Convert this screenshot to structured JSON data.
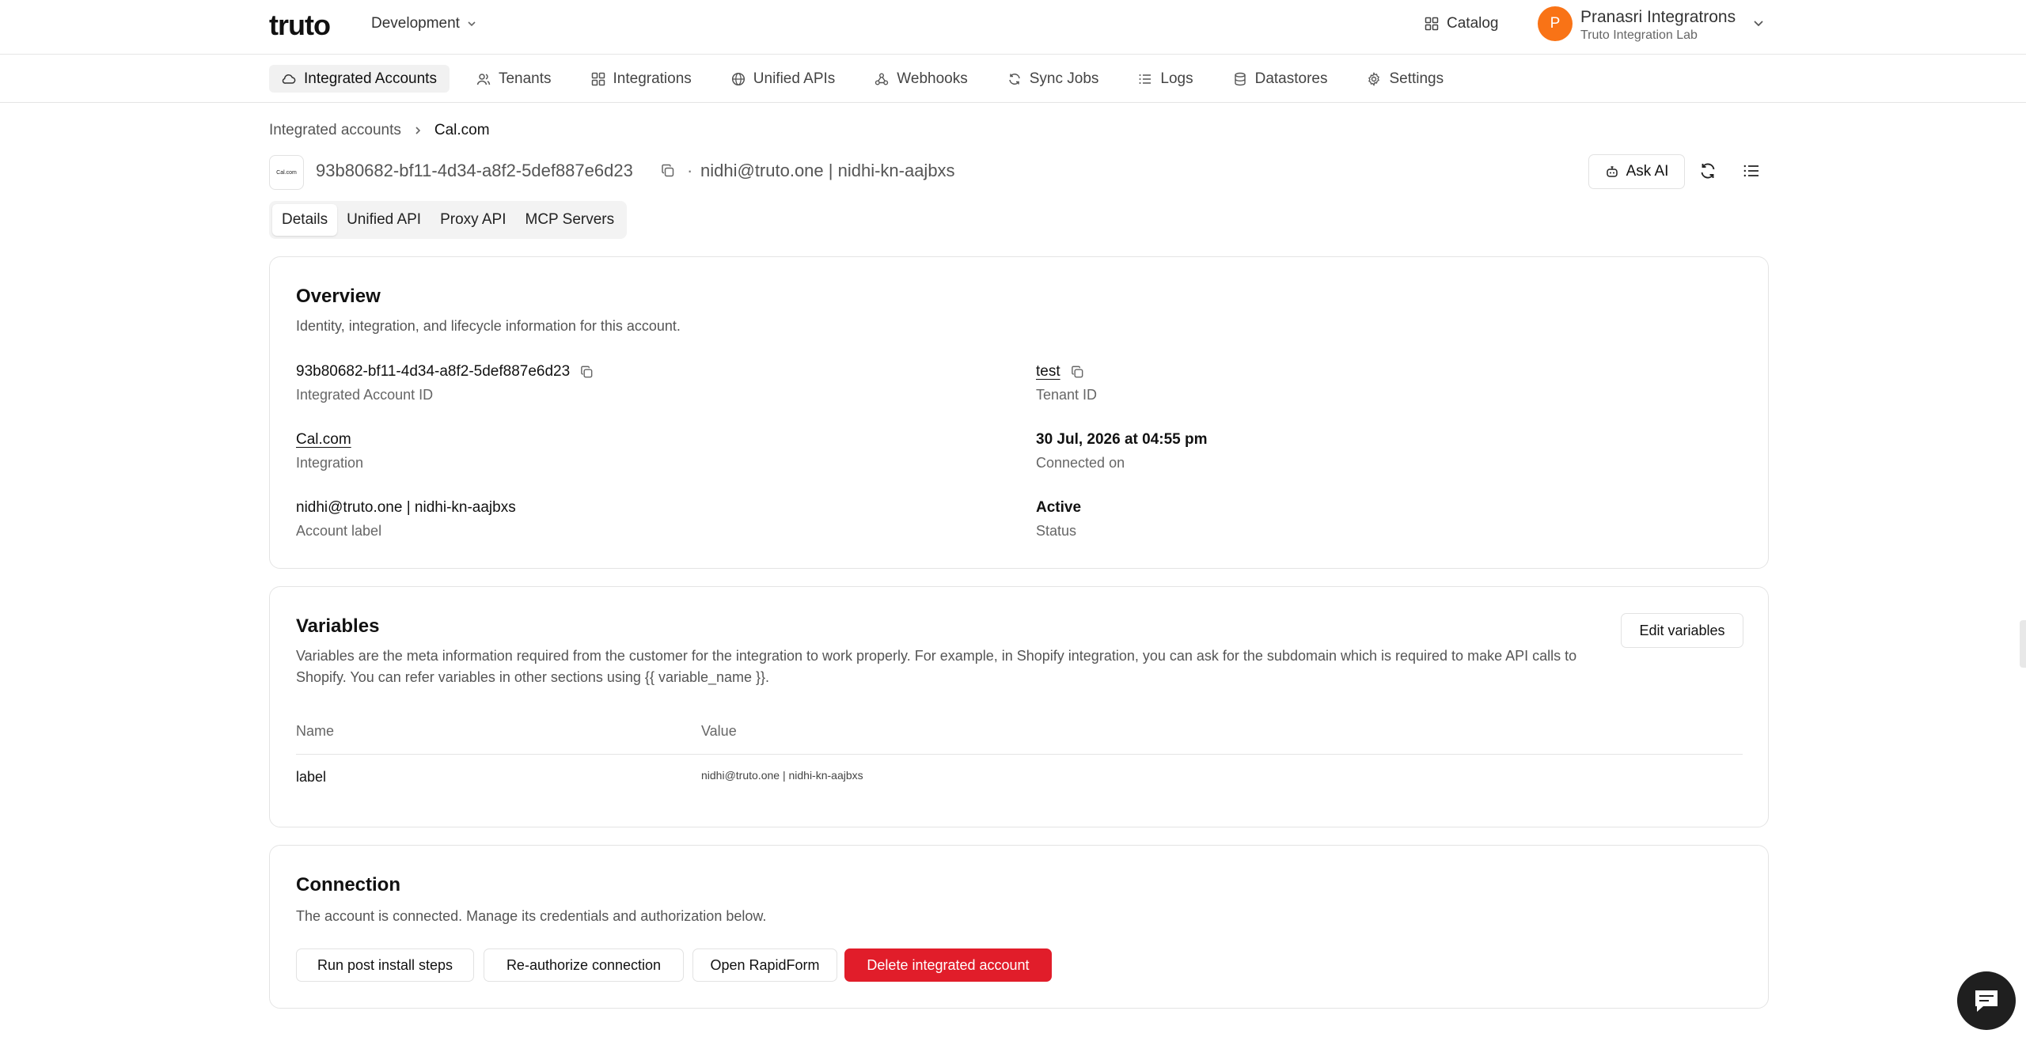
{
  "header": {
    "logo_text": "truto",
    "environment": "Development",
    "catalog_label": "Catalog",
    "user": {
      "initial": "P",
      "name": "Pranasri Integratrons",
      "org": "Truto Integration Lab"
    }
  },
  "nav": {
    "items": [
      {
        "label": "Integrated Accounts",
        "icon": "cloud-icon",
        "active": true
      },
      {
        "label": "Tenants",
        "icon": "users-icon"
      },
      {
        "label": "Integrations",
        "icon": "grid-icon"
      },
      {
        "label": "Unified APIs",
        "icon": "globe-icon"
      },
      {
        "label": "Webhooks",
        "icon": "webhook-icon"
      },
      {
        "label": "Sync Jobs",
        "icon": "sync-icon"
      },
      {
        "label": "Logs",
        "icon": "list-icon"
      },
      {
        "label": "Datastores",
        "icon": "database-icon"
      },
      {
        "label": "Settings",
        "icon": "gear-icon"
      }
    ]
  },
  "breadcrumb": {
    "parent": "Integrated accounts",
    "current": "Cal.com"
  },
  "account": {
    "logo_text": "Cal.com",
    "id": "93b80682-bf11-4d34-a8f2-5def887e6d23",
    "separator": "·",
    "label": "nidhi@truto.one | nidhi-kn-aajbxs",
    "ask_ai_label": "Ask AI"
  },
  "tabs": [
    {
      "label": "Details",
      "active": true
    },
    {
      "label": "Unified API"
    },
    {
      "label": "Proxy API"
    },
    {
      "label": "MCP Servers"
    }
  ],
  "overview": {
    "title": "Overview",
    "description": "Identity, integration, and lifecycle information for this account.",
    "fields": {
      "account_id": {
        "value": "93b80682-bf11-4d34-a8f2-5def887e6d23",
        "label": "Integrated Account ID"
      },
      "tenant_id": {
        "value": "test",
        "label": "Tenant ID"
      },
      "integration": {
        "value": "Cal.com",
        "label": "Integration"
      },
      "connected_on": {
        "value": "30 Jul, 2026 at 04:55 pm",
        "label": "Connected on"
      },
      "account_label": {
        "value": "nidhi@truto.one | nidhi-kn-aajbxs",
        "label": "Account label"
      },
      "status": {
        "value": "Active",
        "label": "Status"
      }
    }
  },
  "variables": {
    "title": "Variables",
    "description": "Variables are the meta information required from the customer for the integration to work properly. For example, in Shopify integration, you can ask for the subdomain which is required to make API calls to Shopify. You can refer variables in other sections using {{ variable_name }}.",
    "edit_label": "Edit variables",
    "columns": [
      "Name",
      "Value"
    ],
    "rows": [
      {
        "name": "label",
        "value": "nidhi@truto.one | nidhi-kn-aajbxs"
      }
    ]
  },
  "connection": {
    "title": "Connection",
    "description": "The account is connected. Manage its credentials and authorization below.",
    "buttons": {
      "post_install": "Run post install steps",
      "reauthorize": "Re-authorize connection",
      "rapidform": "Open RapidForm",
      "delete": "Delete integrated account"
    }
  },
  "colors": {
    "accent_avatar": "#f97316",
    "danger": "#e11d2a",
    "border": "#e4e4e4"
  }
}
